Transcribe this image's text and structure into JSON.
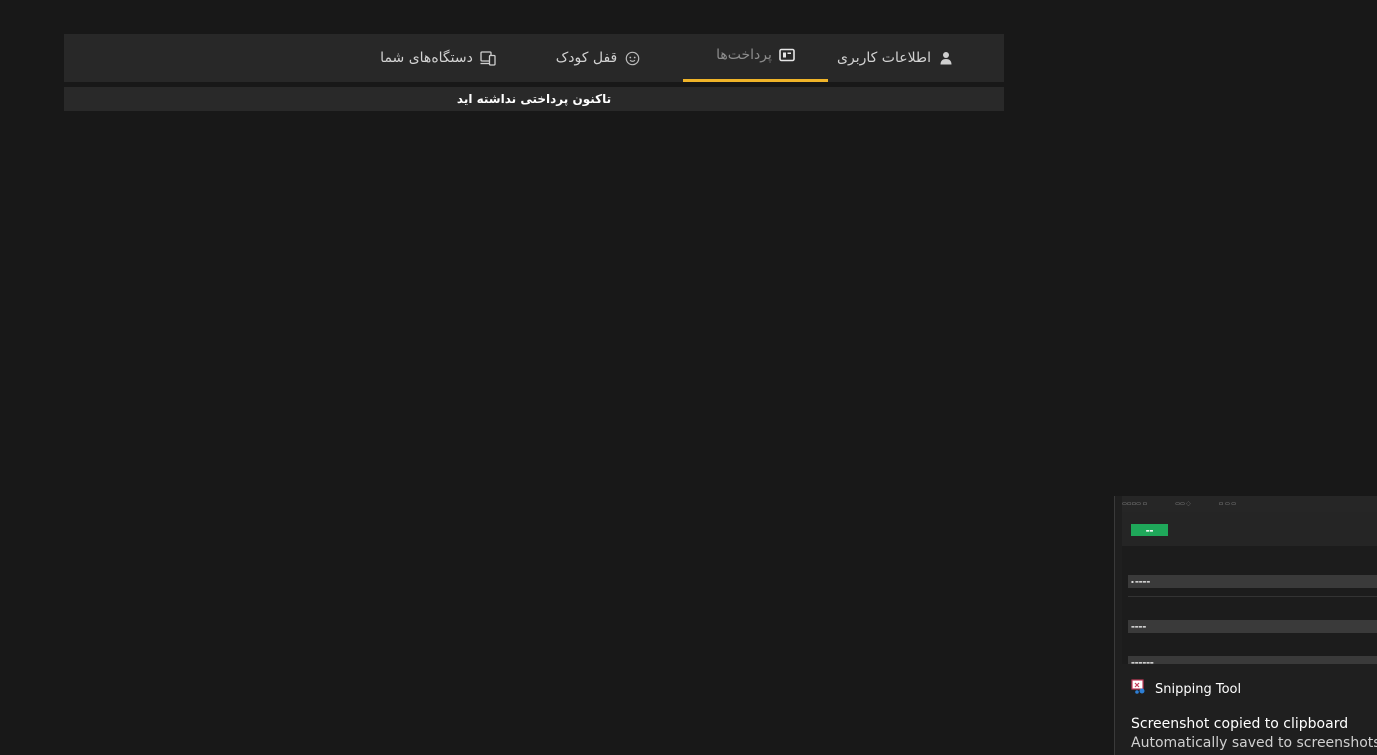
{
  "tabs": [
    {
      "label": "اطلاعات کاربری",
      "icon": "user-icon",
      "active": false
    },
    {
      "label": "پرداخت‌ها",
      "icon": "payment-icon",
      "active": true
    },
    {
      "label": "قفل کودک",
      "icon": "child-face-icon",
      "active": false
    },
    {
      "label": "دستگاه‌های شما",
      "icon": "devices-icon",
      "active": false
    }
  ],
  "payments": {
    "empty_message": "تاکنون پرداختی نداشته اید"
  },
  "colors": {
    "background": "#181818",
    "tab_bar": "#282828",
    "active_underline": "#f0b429",
    "preview_button": "#1fa85a"
  },
  "notification": {
    "app_name": "Snipping Tool",
    "title": "Screenshot copied to clipboard",
    "body": "Automatically saved to screenshots folde"
  }
}
